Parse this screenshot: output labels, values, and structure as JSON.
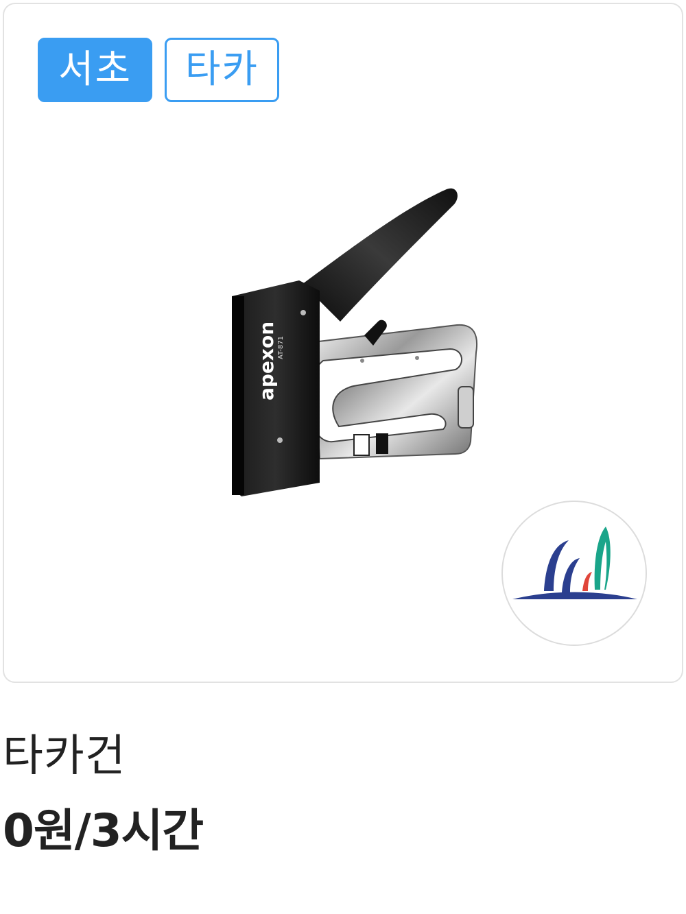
{
  "tags": [
    {
      "label": "서초",
      "style": "filled"
    },
    {
      "label": "타카",
      "style": "outline"
    }
  ],
  "product": {
    "name": "타카건",
    "price": "0원/3시간",
    "image_brand_text": "apexon",
    "image_model_text": "AT-871"
  },
  "colors": {
    "tag_accent": "#3a9df2",
    "text_primary": "#222222",
    "border": "#e2e2e2"
  },
  "icons": {
    "provider_logo": "seocho-district-logo"
  }
}
